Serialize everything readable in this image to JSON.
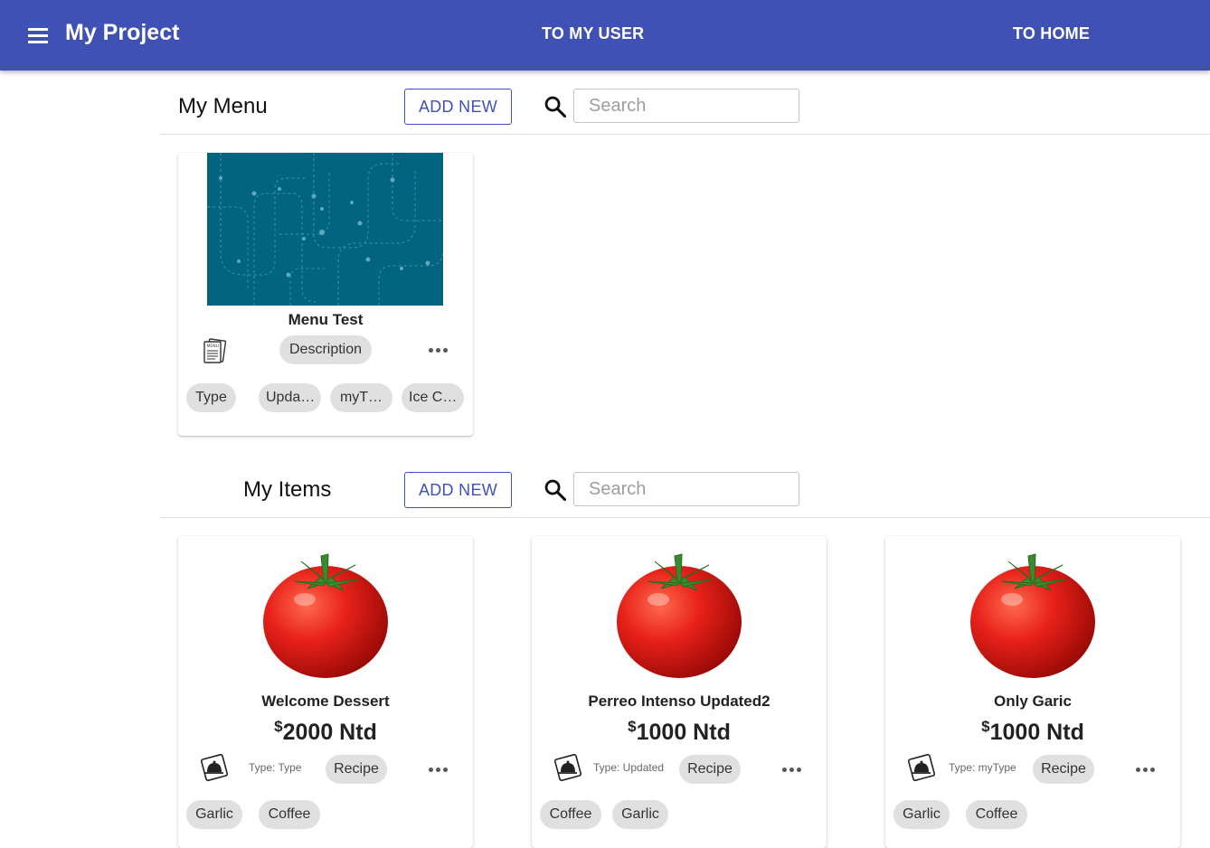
{
  "appbar": {
    "title": "My Project",
    "nav_user": "TO MY USER",
    "nav_home": "TO HOME",
    "color": "#3f51b5"
  },
  "menu_section": {
    "title": "My Menu",
    "add_label": "ADD NEW",
    "search_placeholder": "Search",
    "cards": [
      {
        "name": "Menu Test",
        "description_chip": "Description",
        "tags": [
          "Type",
          "Upda…",
          "myT…",
          "Ice C…"
        ]
      }
    ]
  },
  "items_section": {
    "title": "My Items",
    "add_label": "ADD NEW",
    "search_placeholder": "Search",
    "currency_symbol": "$",
    "cards": [
      {
        "name": "Welcome Dessert",
        "price": "2000 Ntd",
        "type": "Type: Type",
        "recipe_chip": "Recipe",
        "tags": [
          "Garlic",
          "Coffee"
        ]
      },
      {
        "name": "Perreo Intenso Updated2",
        "price": "1000 Ntd",
        "type": "Type: Updated",
        "recipe_chip": "Recipe",
        "tags": [
          "Coffee",
          "Garlic"
        ]
      },
      {
        "name": "Only Garic",
        "price": "1000 Ntd",
        "type": "Type: myType",
        "recipe_chip": "Recipe",
        "tags": [
          "Garlic",
          "Coffee"
        ]
      }
    ]
  }
}
